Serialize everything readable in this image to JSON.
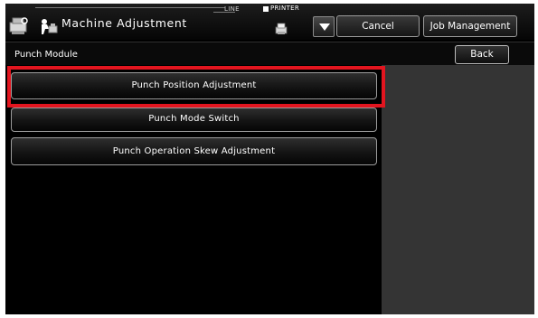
{
  "header": {
    "title": "Machine Adjustment",
    "line_label": "LINE",
    "printer_label": "PRINTER",
    "cancel_label": "Cancel",
    "job_management_label": "Job Management",
    "icons": [
      "machine-settings-icon",
      "adjustment-icon",
      "printer-icon",
      "dropdown-triangle-icon"
    ]
  },
  "breadcrumb": {
    "label": "Punch Module",
    "back_label": "Back"
  },
  "menu": {
    "items": [
      {
        "label": "Punch Position Adjustment",
        "highlighted": true
      },
      {
        "label": "Punch Mode Switch",
        "highlighted": false
      },
      {
        "label": "Punch Operation Skew Adjustment",
        "highlighted": false
      }
    ]
  },
  "colors": {
    "highlight": "#e3151f",
    "background": "#000000",
    "side_panel": "#343434"
  }
}
